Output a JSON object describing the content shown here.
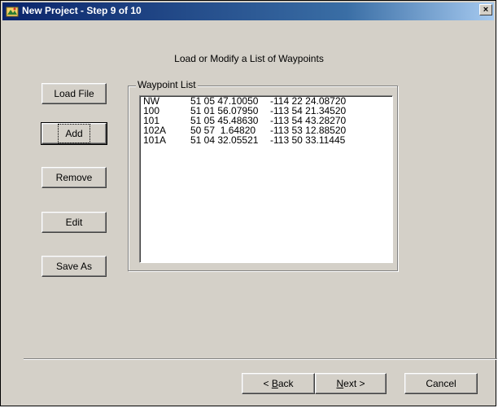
{
  "window": {
    "title": "New Project - Step 9 of 10",
    "close_label": "×"
  },
  "heading": "Load or Modify a List of Waypoints",
  "buttons": {
    "load_file": "Load File",
    "add": "Add",
    "remove": "Remove",
    "edit": "Edit",
    "save_as": "Save As"
  },
  "waypoint_group": {
    "legend": "Waypoint List",
    "rows": [
      {
        "name": "NW",
        "lat": "51 05 47.10050",
        "lon": "-114 22 24.08720"
      },
      {
        "name": "100",
        "lat": "51 01 56.07950",
        "lon": "-113 54 21.34520"
      },
      {
        "name": "101",
        "lat": "51 05 45.48630",
        "lon": "-113 54 43.28270"
      },
      {
        "name": "102A",
        "lat": "50 57  1.64820",
        "lon": "-113 53 12.88520"
      },
      {
        "name": "101A",
        "lat": "51 04 32.05521",
        "lon": "-113 50 33.11445"
      }
    ]
  },
  "footer": {
    "back_accel": "B",
    "back_rest": "ack",
    "back_prefix": "< ",
    "next_accel": "N",
    "next_rest": "ext >",
    "cancel": "Cancel"
  },
  "icons": {
    "title_icon": "project-wizard-icon"
  }
}
